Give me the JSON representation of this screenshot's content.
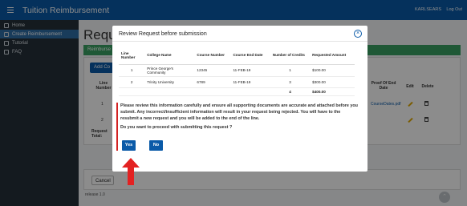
{
  "app": {
    "title": "Tuition Reimbursement",
    "user": "KARLSEARS",
    "logout": "Log Out"
  },
  "sidebar": {
    "items": [
      {
        "label": "Home",
        "icon": "home-icon"
      },
      {
        "label": "Create Reimbursement",
        "icon": "create-icon"
      },
      {
        "label": "Tutorial",
        "icon": "tutorial-icon"
      },
      {
        "label": "FAQ",
        "icon": "faq-icon"
      }
    ]
  },
  "background": {
    "heading": "Reque",
    "band": "Reimburse",
    "add_button": "Add Co",
    "col_line": "Line Number",
    "col_proof": "Proof Of End Date",
    "col_edit": "Edit",
    "col_delete": "Delete",
    "row1_line": "1",
    "row1_proof": "CourseDates.pdf",
    "row2_line": "2",
    "request_total": "Request Total:",
    "cancel": "Cancel",
    "release": "release 1.0"
  },
  "modal": {
    "title": "Review Request before submission",
    "close": "×",
    "columns": [
      "Line Number",
      "College Name",
      "Course Number",
      "Course End Date",
      "Number of Credits",
      "Requested Amount"
    ],
    "rows": [
      {
        "line": "1",
        "college": "Prince George's Community",
        "course": "12345",
        "end_date": "11-FEB-19",
        "credits": "1",
        "amount": "$100.00"
      },
      {
        "line": "2",
        "college": "Trinity University",
        "course": "6789",
        "end_date": "11-FEB-19",
        "credits": "3",
        "amount": "$300.00"
      }
    ],
    "totals": {
      "credits": "4",
      "amount": "$400.00"
    },
    "warning": "Please review this information carefully and ensure all supporting documents are accurate and attached before you submit. Any incorrect/insufficient information will result in your request being rejected. You will have to the resubmit a new request and you will be added to the end of the line.",
    "question": "Do you want to proceed with submitting this request ?",
    "yes": "Yes",
    "no": "No"
  },
  "colors": {
    "primary": "#0a5aa8",
    "sidebar": "#26313a",
    "band": "#3aa163",
    "arrow": "#e32121"
  }
}
